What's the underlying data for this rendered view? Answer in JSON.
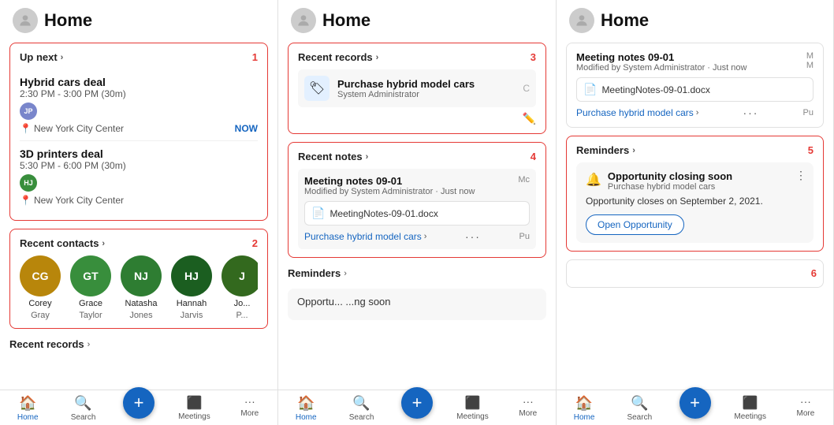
{
  "panels": [
    {
      "id": "panel-1",
      "header": {
        "title": "Home"
      },
      "sections": {
        "up_next": {
          "label": "Up next",
          "number": "1",
          "events": [
            {
              "title": "Hybrid cars deal",
              "time": "2:30 PM - 3:00 PM (30m)",
              "user_initials": "JP",
              "user_color": "#7986cb",
              "location": "New York City Center",
              "badge": "NOW"
            },
            {
              "title": "3D printers deal",
              "time": "5:30 PM - 6:00 PM (30m)",
              "user_initials": "HJ",
              "user_color": "#388e3c",
              "location": "New York City Center",
              "badge": ""
            }
          ]
        },
        "recent_contacts": {
          "label": "Recent contacts",
          "number": "2",
          "contacts": [
            {
              "initials": "CG",
              "name": "Corey",
              "last": "Gray",
              "color": "#b8860b"
            },
            {
              "initials": "GT",
              "name": "Grace",
              "last": "Taylor",
              "color": "#388e3c"
            },
            {
              "initials": "NJ",
              "name": "Natasha",
              "last": "Jones",
              "color": "#2e7d32"
            },
            {
              "initials": "HJ",
              "name": "Hannah",
              "last": "Jarvis",
              "color": "#1b5e20"
            },
            {
              "initials": "J",
              "name": "Jo...",
              "last": "P...",
              "color": "#33691e"
            }
          ]
        },
        "recent_records": {
          "label": "Recent records"
        }
      },
      "nav": {
        "items": [
          {
            "label": "Home",
            "icon": "🏠",
            "active": true
          },
          {
            "label": "Search",
            "icon": "🔍",
            "active": false
          },
          {
            "label": "+",
            "icon": "+",
            "is_add": true
          },
          {
            "label": "Meetings",
            "icon": "▦",
            "active": false
          },
          {
            "label": "More",
            "icon": "···",
            "active": false
          }
        ]
      }
    },
    {
      "id": "panel-2",
      "header": {
        "title": "Home"
      },
      "sections": {
        "recent_records": {
          "label": "Recent records",
          "number": "3",
          "records": [
            {
              "title": "Purchase hybrid model cars",
              "sub": "System Administrator",
              "icon": "🏷"
            }
          ]
        },
        "recent_notes": {
          "label": "Recent notes",
          "number": "4",
          "notes": [
            {
              "title": "Meeting notes 09-01",
              "sub": "Modified by System Administrator · Just now",
              "sub2": "Mc",
              "attachment": "MeetingNotes-09-01.docx",
              "link": "Purchase hybrid model cars",
              "dots": "···"
            }
          ]
        },
        "reminders": {
          "label": "Reminders"
        }
      },
      "nav": {
        "items": [
          {
            "label": "Home",
            "icon": "🏠",
            "active": true
          },
          {
            "label": "Search",
            "icon": "🔍",
            "active": false
          },
          {
            "label": "+",
            "icon": "+",
            "is_add": true
          },
          {
            "label": "Meetings",
            "icon": "▦",
            "active": false
          },
          {
            "label": "More",
            "icon": "···",
            "active": false
          }
        ]
      }
    },
    {
      "id": "panel-3",
      "header": {
        "title": "Home"
      },
      "sections": {
        "meeting_note": {
          "title": "Meeting notes 09-01",
          "meta": "Modified by System Administrator · Just now",
          "meta2": "M\nM",
          "attachment": "MeetingNotes-09-01.docx",
          "link": "Purchase hybrid model cars",
          "link2": "Pu"
        },
        "reminders": {
          "label": "Reminders",
          "number": "5",
          "item": {
            "icon": "🔔",
            "title": "Opportunity closing soon",
            "sub": "Purchase hybrid model cars",
            "desc": "Opportunity closes on\nSeptember 2, 2021.",
            "btn": "Open Opportunity"
          }
        },
        "bottom_number": "6"
      },
      "nav": {
        "items": [
          {
            "label": "Home",
            "icon": "🏠",
            "active": true
          },
          {
            "label": "Search",
            "icon": "🔍",
            "active": false
          },
          {
            "label": "+",
            "icon": "+",
            "is_add": true
          },
          {
            "label": "Meetings",
            "icon": "▦",
            "active": false
          },
          {
            "label": "More",
            "icon": "···",
            "active": false
          }
        ]
      }
    }
  ]
}
